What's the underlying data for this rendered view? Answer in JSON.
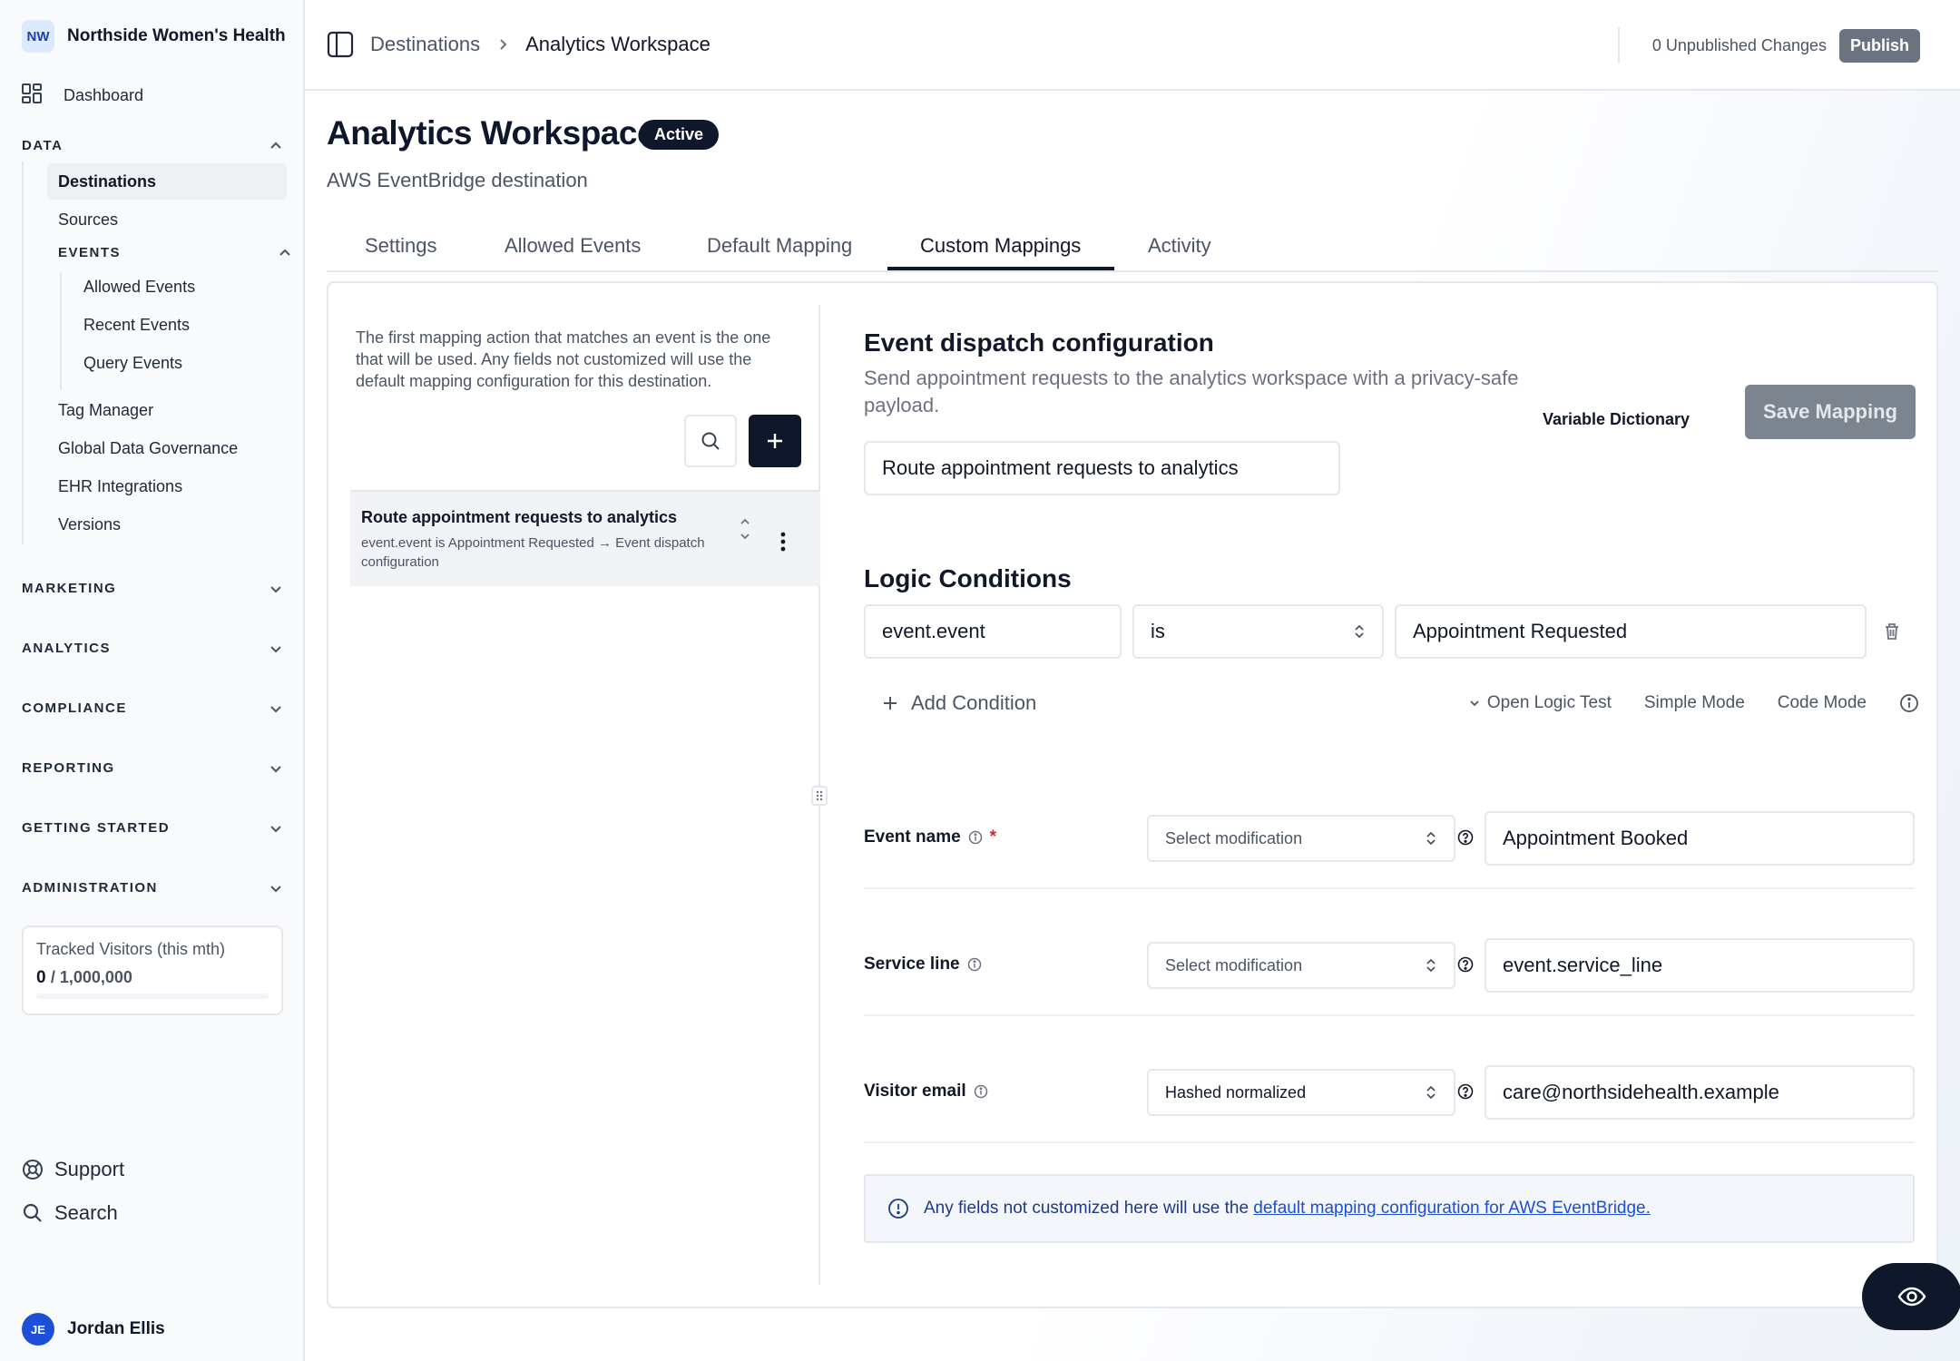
{
  "org": {
    "initials": "NW",
    "name": "Northside Women's Health"
  },
  "nav": {
    "dashboard": "Dashboard",
    "data_section": "DATA",
    "data_items": [
      "Destinations",
      "Sources"
    ],
    "events_section": "EVENTS",
    "event_items": [
      "Allowed Events",
      "Recent Events",
      "Query Events"
    ],
    "data_items_after": [
      "Tag Manager",
      "Global Data Governance",
      "EHR Integrations",
      "Versions"
    ],
    "sections": [
      "MARKETING",
      "ANALYTICS",
      "COMPLIANCE",
      "REPORTING",
      "GETTING STARTED",
      "ADMINISTRATION"
    ]
  },
  "visitors": {
    "label": "Tracked Visitors (this mth)",
    "count": "0",
    "limit": "/ 1,000,000",
    "progress": 0
  },
  "bottom": {
    "support": "Support",
    "search": "Search"
  },
  "user": {
    "initials": "JE",
    "name": "Jordan Ellis"
  },
  "topbar": {
    "breadcrumb_parent": "Destinations",
    "breadcrumb_current": "Analytics Workspace",
    "unpublished": "0 Unpublished Changes",
    "publish": "Publish"
  },
  "header": {
    "title": "Analytics Workspace",
    "status": "Active",
    "subtitle": "AWS EventBridge destination",
    "tabs": [
      "Settings",
      "Allowed Events",
      "Default Mapping",
      "Custom Mappings",
      "Activity"
    ],
    "active_tab": "Custom Mappings"
  },
  "left_panel": {
    "help": "The first mapping action that matches an event is the one that will be used. Any fields not customized will use the default mapping configuration for this destination.",
    "rule": {
      "title": "Route appointment requests to analytics",
      "desc": "event.event is Appointment Requested → Event dispatch configuration"
    }
  },
  "config": {
    "title": "Event dispatch configuration",
    "desc": "Send appointment requests to the analytics workspace with a privacy-safe payload.",
    "variable_dictionary": "Variable Dictionary",
    "save": "Save Mapping",
    "name_value": "Route appointment requests to analytics"
  },
  "logic": {
    "title": "Logic Conditions",
    "field": "event.event",
    "operator": "is",
    "value": "Appointment Requested",
    "add_condition": "Add Condition",
    "open_test": "Open Logic Test",
    "simple_mode": "Simple Mode",
    "code_mode": "Code Mode"
  },
  "mappings": [
    {
      "label": "Event name",
      "required": "*",
      "modification": "Select modification",
      "value": "Appointment Booked"
    },
    {
      "label": "Service line",
      "modification": "Select modification",
      "value": "event.service_line"
    },
    {
      "label": "Visitor email",
      "modification": "Hashed normalized",
      "value": "care@northsidehealth.example"
    }
  ],
  "info": {
    "text": "Any fields not customized here will use the",
    "link": "default mapping configuration for AWS EventBridge."
  },
  "colors": {
    "primary": "#0f172a",
    "accent_link": "#1d4ed8",
    "required": "#dc2626"
  }
}
